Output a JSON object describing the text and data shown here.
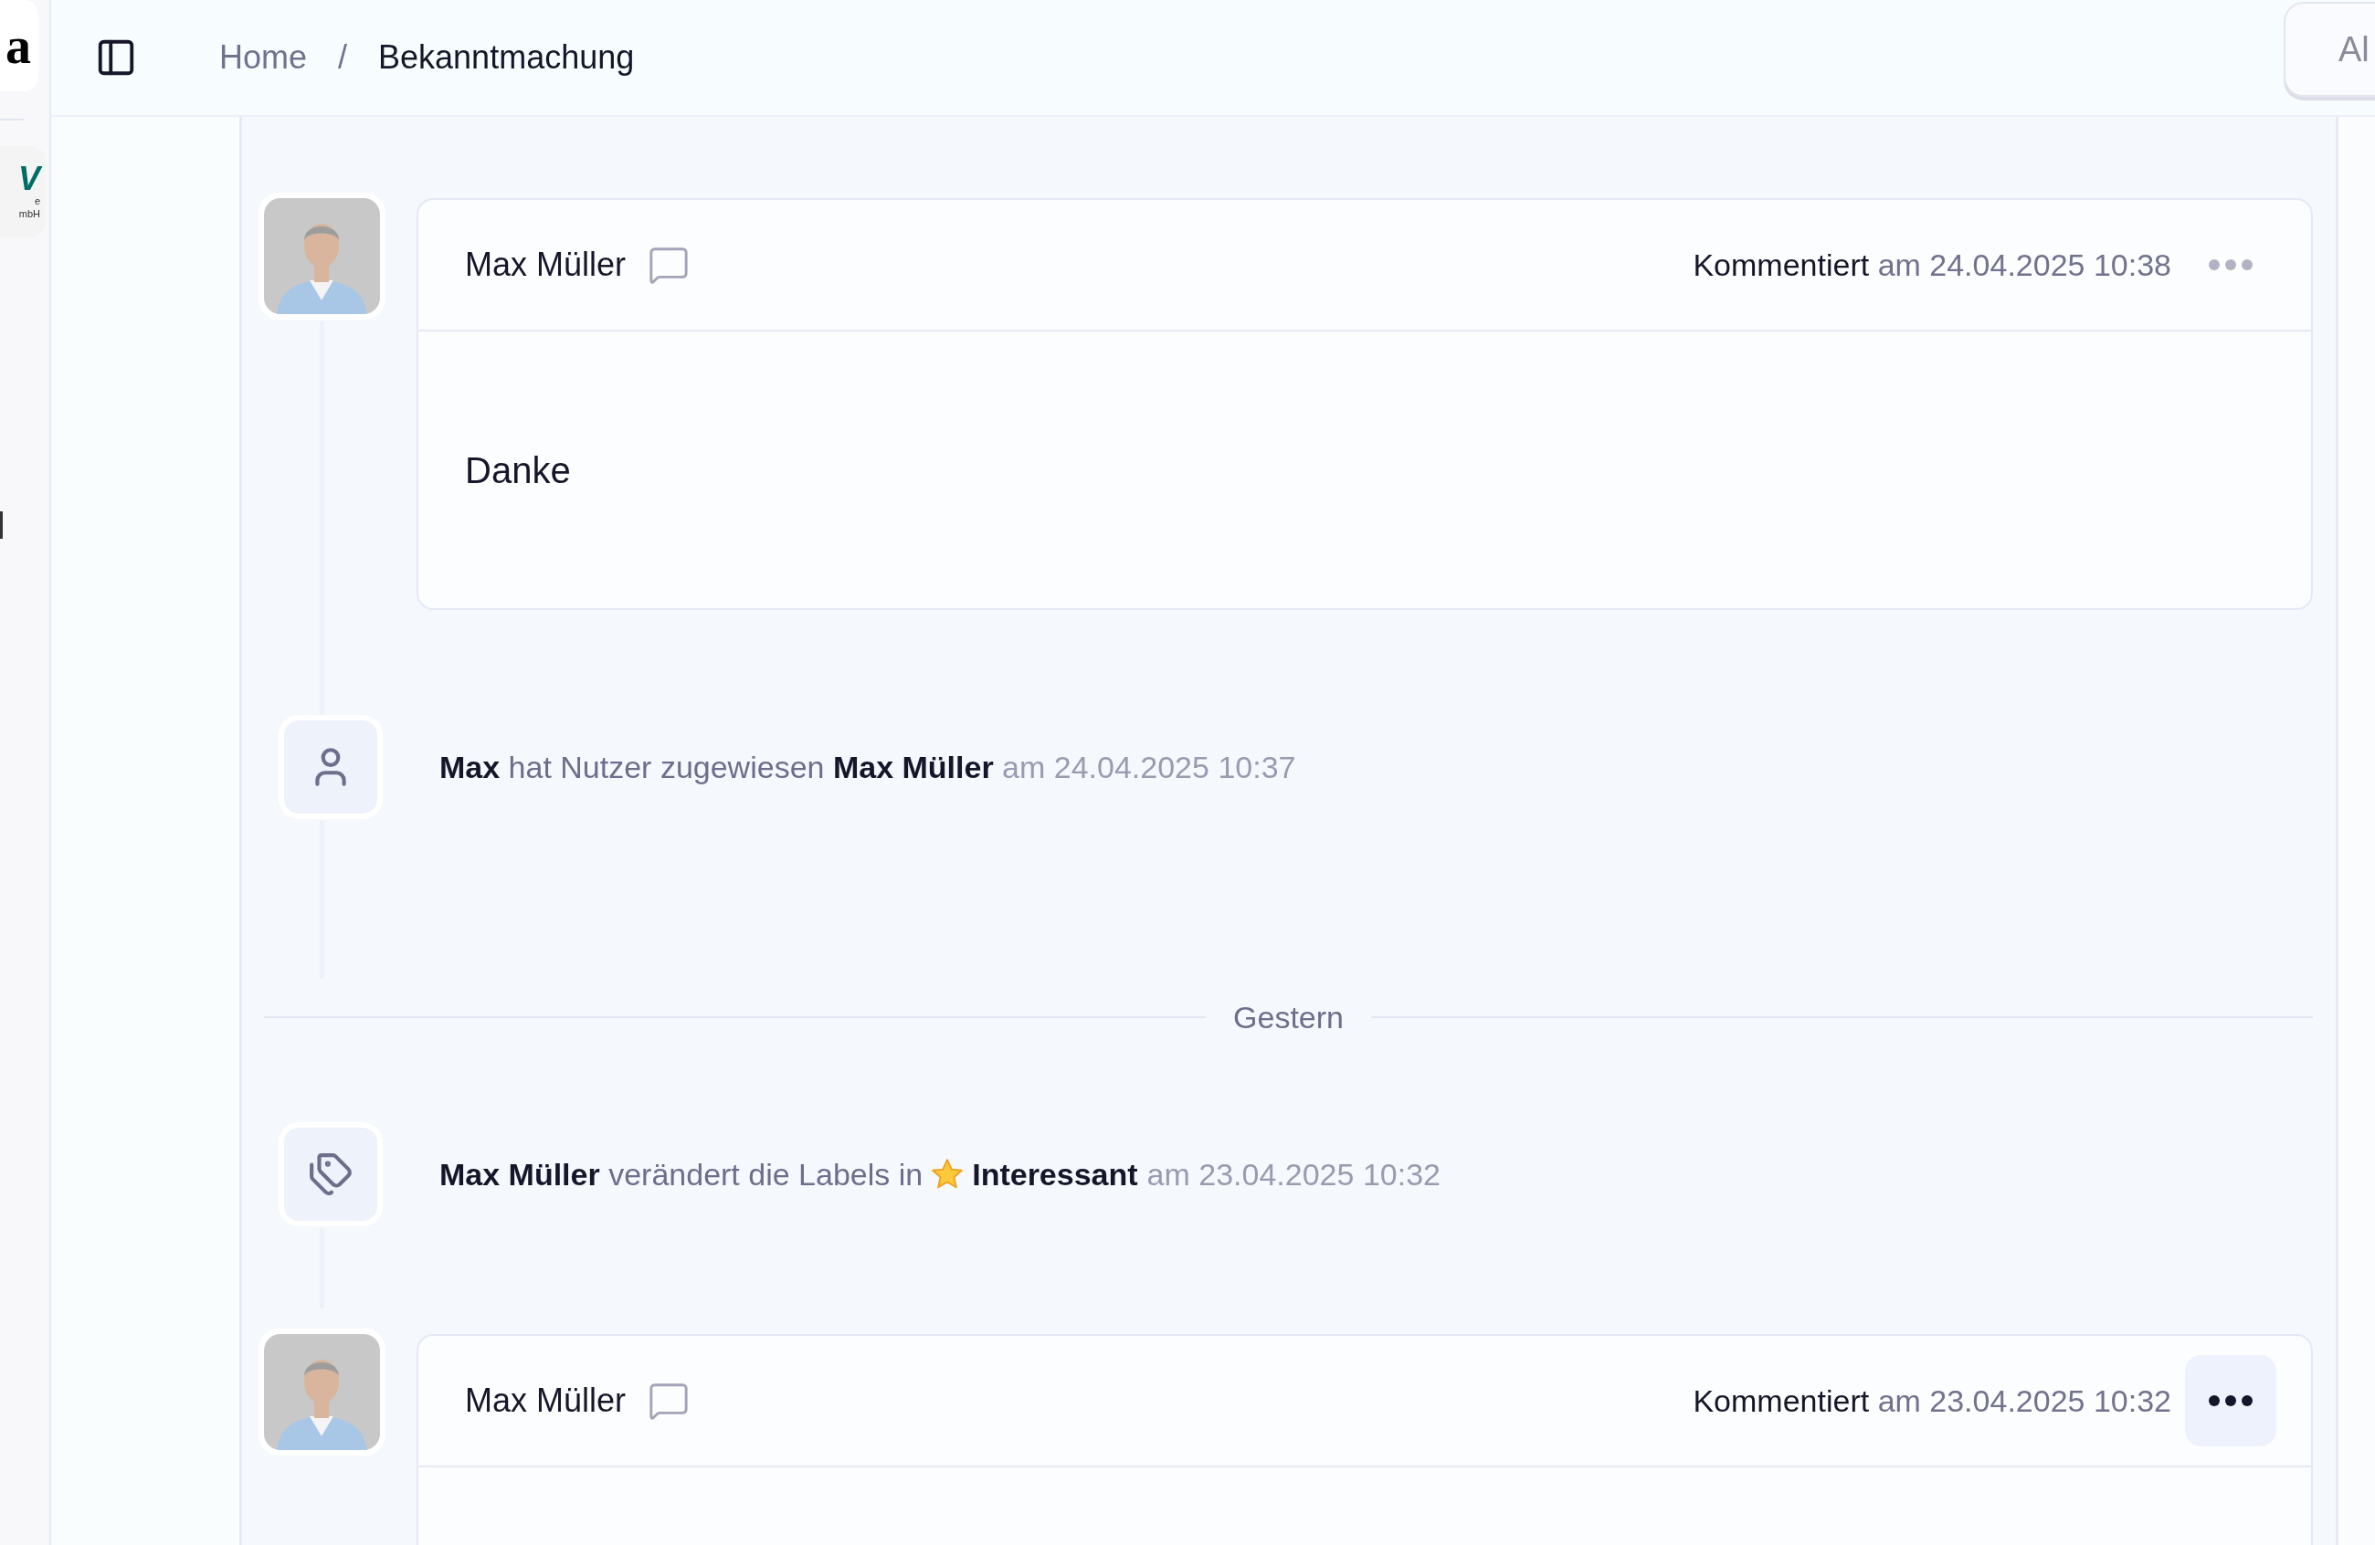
{
  "rail": {
    "logos": [
      {
        "kind": "wordmark",
        "text": "a"
      },
      {
        "kind": "badge",
        "mark": "V",
        "caption": [
          "e",
          "mbH"
        ]
      }
    ]
  },
  "header": {
    "breadcrumb": [
      {
        "label": "Home",
        "current": false
      },
      {
        "label": "Bekanntmachung",
        "current": true
      }
    ],
    "separator": "/",
    "action_button": "Al"
  },
  "timeline": [
    {
      "kind": "comment",
      "author": "Max Müller",
      "action": "Kommentiert",
      "date": "am 24.04.2025 10:38",
      "body": "Danke",
      "menu_active": false
    },
    {
      "kind": "assignment",
      "actor": "Max",
      "verb": "hat Nutzer zugewiesen",
      "target": "Max Müller",
      "date": "am 24.04.2025 10:37"
    },
    {
      "kind": "divider",
      "label": "Gestern"
    },
    {
      "kind": "label_change",
      "actor": "Max Müller",
      "verb": "verändert die Labels in",
      "label": "Interessant",
      "date": "am 23.04.2025 10:32"
    },
    {
      "kind": "comment",
      "author": "Max Müller",
      "action": "Kommentiert",
      "date": "am 23.04.2025 10:32",
      "menu_active": true
    }
  ]
}
